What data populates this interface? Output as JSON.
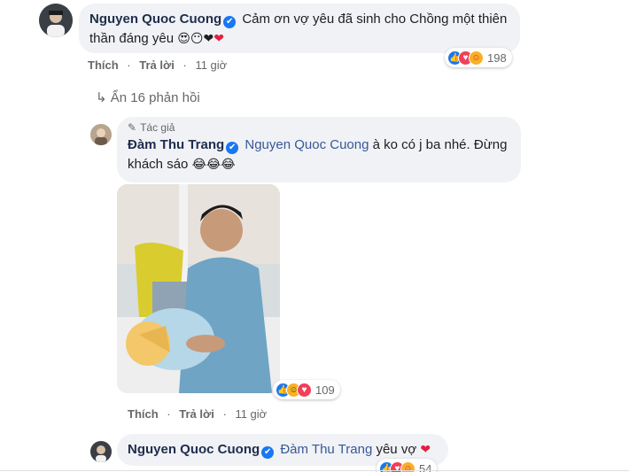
{
  "comment1": {
    "author": "Nguyen Quoc Cuong",
    "verified_mark": "✔",
    "text_line1": "Cảm ơn vợ yêu đã sinh cho Chồng một thiên",
    "text_line2": "thần đáng yêu",
    "emojis": "😍😶❤",
    "heart": "❤",
    "actions": {
      "like": "Thích",
      "reply": "Trả lời",
      "time": "11 giờ"
    },
    "reactions_count": "198"
  },
  "replies_toggle": {
    "label": "Ẩn 16 phản hồi"
  },
  "reply1": {
    "author_tag": "Tác giả",
    "author": "Đàm Thu Trang",
    "verified_mark": "✔",
    "mention": "Nguyen Quoc Cuong",
    "text_after": " à ko có j ba nhé. Đừng",
    "text_line2": "khách sáo",
    "emojis": "😂😂😂",
    "reactions_count": "109",
    "actions": {
      "like": "Thích",
      "reply": "Trả lời",
      "time": "11 giờ"
    }
  },
  "reply2": {
    "author": "Nguyen Quoc Cuong",
    "verified_mark": "✔",
    "mention": "Đàm Thu Trang",
    "text_after": " yêu vợ",
    "heart": "❤",
    "reactions_count": "54"
  },
  "colors": {
    "bubble": "#f0f2f5",
    "name": "#1f2d4d",
    "mention": "#385898",
    "meta": "#65676b",
    "like_blue": "#1877f2"
  }
}
